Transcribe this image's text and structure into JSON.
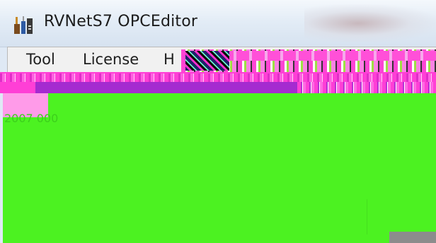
{
  "window": {
    "title": "RVNetS7 OPCEditor",
    "app_icon": "toolbox-app-icon"
  },
  "menubar": {
    "items": [
      {
        "label": "Tool"
      },
      {
        "label": "License"
      },
      {
        "label": "H"
      }
    ]
  },
  "content": {
    "faint_label": "2007 000"
  },
  "colors": {
    "titlebar": "#e3ecf6",
    "menubar": "#f1f1f1",
    "content_fill": "#4cf221",
    "glitch_magenta": "#ff3fd6",
    "glitch_purple": "#a52bd0"
  }
}
